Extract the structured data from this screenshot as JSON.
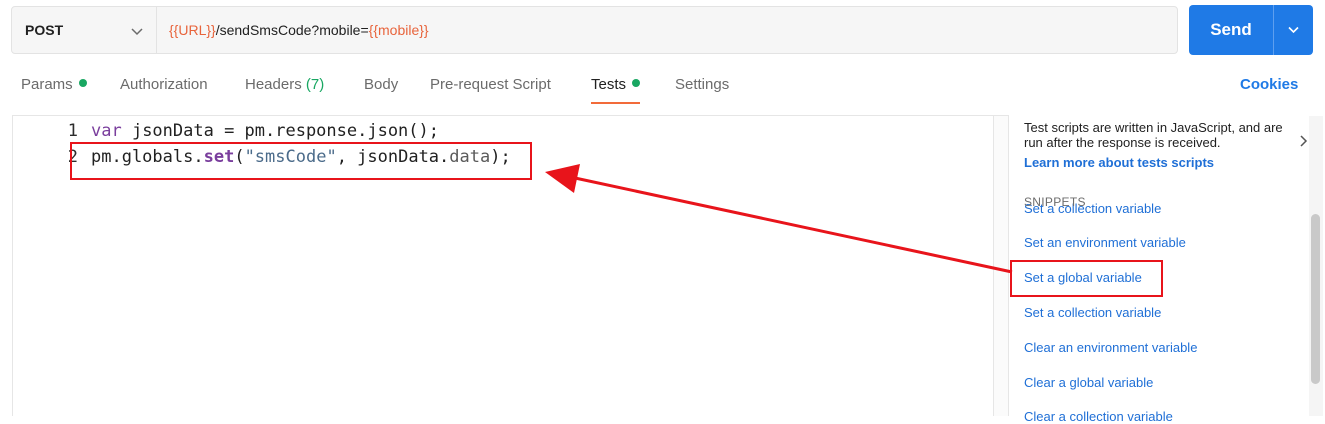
{
  "request": {
    "method": "POST",
    "url_parts": [
      {
        "text": "{{URL}}",
        "var": true
      },
      {
        "text": "/sendSmsCode?mobile=",
        "var": false
      },
      {
        "text": "{{mobile}}",
        "var": true
      }
    ],
    "send_label": "Send"
  },
  "tabs": [
    {
      "label": "Params",
      "dot": true
    },
    {
      "label": "Authorization"
    },
    {
      "label": "Headers",
      "count": "(7)"
    },
    {
      "label": "Body"
    },
    {
      "label": "Pre-request Script"
    },
    {
      "label": "Tests",
      "dot": true,
      "active": true
    },
    {
      "label": "Settings"
    }
  ],
  "cookies_label": "Cookies",
  "editor": {
    "lines": [
      {
        "num": "1",
        "code": "var jsonData = pm.response.json();"
      },
      {
        "num": "2",
        "code": "pm.globals.set(\"smsCode\", jsonData.data);"
      }
    ]
  },
  "side": {
    "description": "Test scripts are written in JavaScript, and are run after the response is received.",
    "learn_more": "Learn more about tests scripts",
    "snippets_heading": "SNIPPETS",
    "snippets": [
      "Set a collection variable",
      "Set an environment variable",
      "Set a global variable",
      "Set a collection variable",
      "Clear an environment variable",
      "Clear a global variable",
      "Clear a collection variable"
    ]
  },
  "colors": {
    "accent": "#1f7ae6",
    "variable": "#e8643c",
    "tab_indicator": "#f26b3a",
    "status_dot": "#19a762",
    "annotation": "#e8141b"
  }
}
